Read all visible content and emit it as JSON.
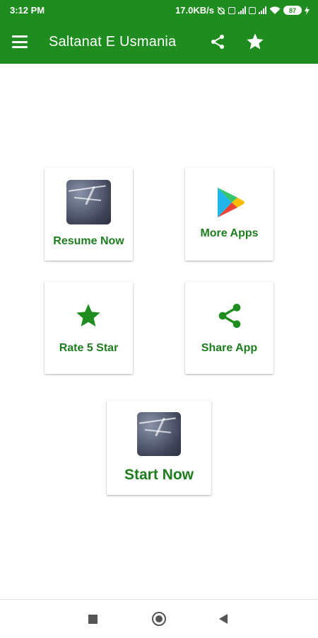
{
  "status_bar": {
    "time": "3:12 PM",
    "network_speed": "17.0KB/s",
    "battery": "87"
  },
  "app_bar": {
    "title": "Saltanat E Usmania",
    "icons": [
      "menu-icon",
      "share-icon",
      "star-icon"
    ]
  },
  "grid": {
    "resume": {
      "label": "Resume Now"
    },
    "more_apps": {
      "label": "More Apps"
    },
    "rate": {
      "label": "Rate 5 Star"
    },
    "share": {
      "label": "Share App"
    },
    "start": {
      "label": "Start Now"
    }
  },
  "colors": {
    "primary": "#1e8c1e",
    "label": "#1e7d1e"
  },
  "nav_bar": {
    "icons": [
      "recents-icon",
      "home-icon",
      "back-icon"
    ]
  }
}
